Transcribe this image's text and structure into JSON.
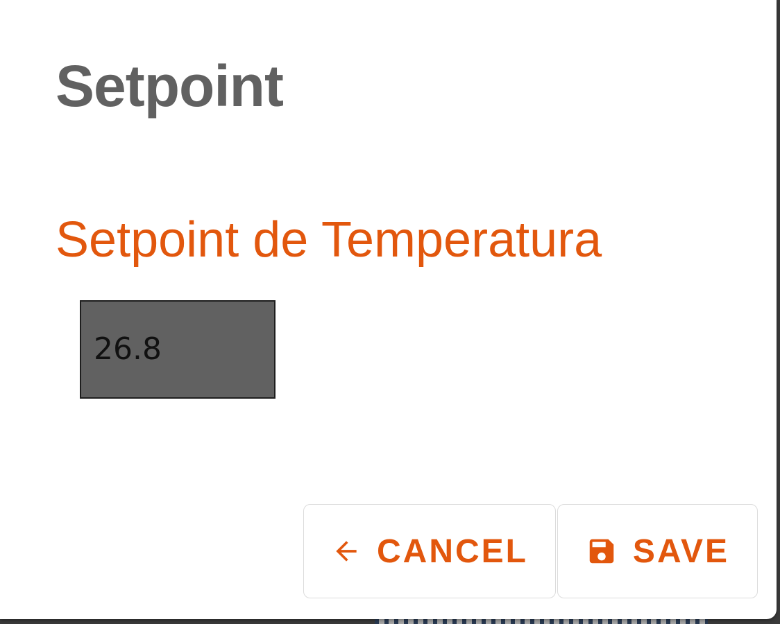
{
  "dialog": {
    "title": "Setpoint",
    "field": {
      "label": "Setpoint de Temperatura",
      "value": "26.8"
    },
    "actions": {
      "cancel": {
        "label": "CANCEL",
        "icon": "arrow-left-icon"
      },
      "save": {
        "label": "SAVE",
        "icon": "floppy-disk-icon"
      }
    }
  },
  "colors": {
    "accent": "#e2570d",
    "title": "#616161",
    "input_background": "#616161"
  }
}
